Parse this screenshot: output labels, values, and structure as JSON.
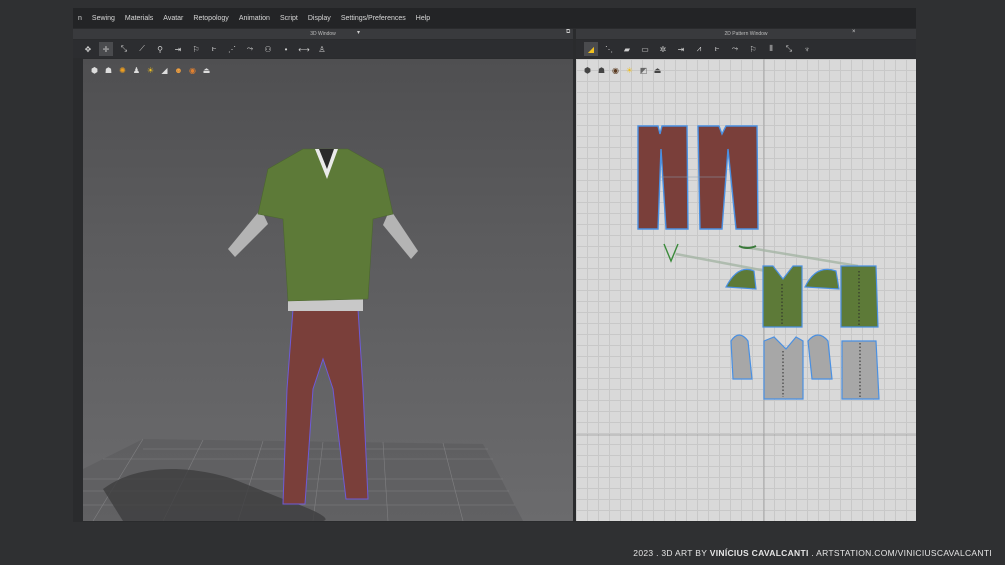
{
  "menu": [
    "n",
    "Sewing",
    "Materials",
    "Avatar",
    "Retopology",
    "Animation",
    "Script",
    "Display",
    "Settings/Preferences",
    "Help"
  ],
  "panel3d": {
    "title": "3D Window"
  },
  "panel2d": {
    "title": "2D Pattern Window"
  },
  "credit": {
    "year": "2023 . 3D ART BY ",
    "artist": "VINÍCIUS CAVALCANTI",
    "site": " . ARTSTATION.COM/VINICIUSCAVALCANTI"
  },
  "colors": {
    "shirt": "#5d7a38",
    "pants": "#7a3f3a",
    "sleeve": "#a7a7a7",
    "outline": "#4a90e2",
    "grid_bg": "#d9d9d9"
  },
  "toolbar3d_icons": [
    "select-icon",
    "move-icon",
    "transform-icon",
    "edit-icon",
    "pin-icon",
    "tack-icon",
    "fold-icon",
    "sew-icon",
    "segment-icon",
    "free-sew-icon",
    "arrange-icon",
    "point-icon",
    "measure-icon",
    "avatar-icon"
  ],
  "toolbar2d_icons": [
    "select-icon",
    "edit-pattern-icon",
    "polygon-icon",
    "rectangle-icon",
    "circle-icon",
    "internal-line-icon",
    "dart-icon",
    "sew-icon",
    "segment-sew-icon",
    "fold-icon",
    "trace-icon",
    "notch-icon"
  ]
}
